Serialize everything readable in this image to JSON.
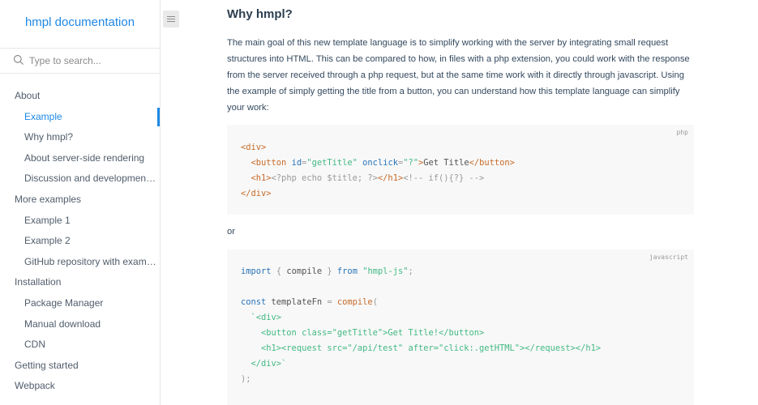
{
  "sidebar": {
    "app_name": "hmpl documentation",
    "search_placeholder": "Type to search...",
    "items": [
      {
        "label": "About",
        "level": 1
      },
      {
        "label": "Example",
        "level": 2,
        "active": true
      },
      {
        "label": "Why hmpl?",
        "level": 2
      },
      {
        "label": "About server-side rendering",
        "level": 2
      },
      {
        "label": "Discussion and development of a library",
        "level": 2
      },
      {
        "label": "More examples",
        "level": 1
      },
      {
        "label": "Example 1",
        "level": 2
      },
      {
        "label": "Example 2",
        "level": 2
      },
      {
        "label": "GitHub repository with examples",
        "level": 2
      },
      {
        "label": "Installation",
        "level": 1
      },
      {
        "label": "Package Manager",
        "level": 2
      },
      {
        "label": "Manual download",
        "level": 2
      },
      {
        "label": "CDN",
        "level": 2
      },
      {
        "label": "Getting started",
        "level": 1
      },
      {
        "label": "Webpack",
        "level": 1
      }
    ]
  },
  "main": {
    "heading": "Why hmpl?",
    "paragraph": "The main goal of this new template language is to simplify working with the server by integrating small request structures into HTML. This can be compared to how, in files with a php extension, you could work with the response from the server received through a php request, but at the same time work with it directly through javascript. Using the example of simply getting the title from a button, you can understand how this template language can simplify your work:",
    "or_text": "or",
    "code_php": {
      "lang": "php",
      "lines": [
        [
          [
            "tk-tag",
            "<div>"
          ]
        ],
        [
          [
            "tk-text",
            "  "
          ],
          [
            "tk-tag",
            "<button "
          ],
          [
            "tk-attr",
            "id"
          ],
          [
            "tk-punc",
            "="
          ],
          [
            "tk-str",
            "\"getTitle\""
          ],
          [
            "tk-text",
            " "
          ],
          [
            "tk-attr",
            "onclick"
          ],
          [
            "tk-punc",
            "="
          ],
          [
            "tk-str",
            "\"?\""
          ],
          [
            "tk-tag",
            ">"
          ],
          [
            "tk-text",
            "Get Title"
          ],
          [
            "tk-tag",
            "</button>"
          ]
        ],
        [
          [
            "tk-text",
            "  "
          ],
          [
            "tk-tag",
            "<h1>"
          ],
          [
            "tk-punc",
            "<?php echo $title; ?>"
          ],
          [
            "tk-tag",
            "</h1>"
          ],
          [
            "tk-punc",
            "<!-- if(){?} -->"
          ]
        ],
        [
          [
            "tk-tag",
            "</div>"
          ]
        ]
      ]
    },
    "code_js": {
      "lang": "javascript",
      "lines": [
        [
          [
            "tk-kw",
            "import"
          ],
          [
            "tk-text",
            " "
          ],
          [
            "tk-punc",
            "{"
          ],
          [
            "tk-text",
            " compile "
          ],
          [
            "tk-punc",
            "}"
          ],
          [
            "tk-text",
            " "
          ],
          [
            "tk-kw",
            "from"
          ],
          [
            "tk-text",
            " "
          ],
          [
            "tk-str",
            "\"hmpl-js\""
          ],
          [
            "tk-punc",
            ";"
          ]
        ],
        [
          [
            "tk-text",
            ""
          ]
        ],
        [
          [
            "tk-kw",
            "const"
          ],
          [
            "tk-text",
            " templateFn "
          ],
          [
            "tk-punc",
            "="
          ],
          [
            "tk-text",
            " "
          ],
          [
            "tk-fn",
            "compile"
          ],
          [
            "tk-punc",
            "("
          ]
        ],
        [
          [
            "tk-text",
            "  "
          ],
          [
            "tk-str",
            "`<div>"
          ]
        ],
        [
          [
            "tk-str",
            "    <button class=\"getTitle\">Get Title!</button>"
          ]
        ],
        [
          [
            "tk-str",
            "    <h1><request src=\"/api/test\" after=\"click:.getHTML\"></request></h1>"
          ]
        ],
        [
          [
            "tk-str",
            "  </div>`"
          ]
        ],
        [
          [
            "tk-punc",
            ");"
          ]
        ]
      ]
    }
  },
  "icons": {
    "menu": "menu-toggle-icon",
    "search": "search-icon"
  },
  "colors": {
    "accent": "#1e88e5",
    "code_bg": "#f8f8f8"
  }
}
